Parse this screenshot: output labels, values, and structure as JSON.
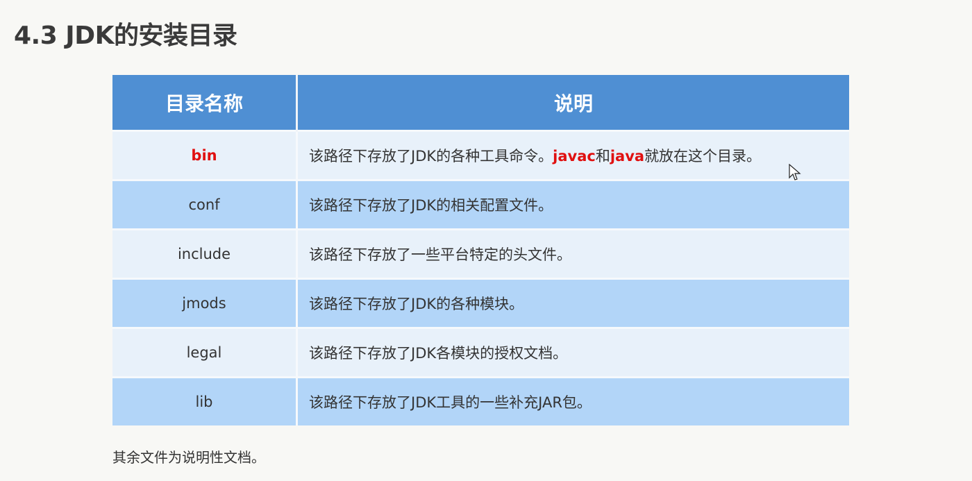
{
  "title": "4.3 JDK的安装目录",
  "table": {
    "headers": [
      "目录名称",
      "说明"
    ],
    "rows": [
      {
        "name": "bin",
        "desc_parts": [
          "该路径下存放了JDK的各种工具命令。",
          "javac",
          "和",
          "java",
          "就放在这个目录。"
        ]
      },
      {
        "name": "conf",
        "desc": "该路径下存放了JDK的相关配置文件。"
      },
      {
        "name": "include",
        "desc": "该路径下存放了一些平台特定的头文件。"
      },
      {
        "name": "jmods",
        "desc": "该路径下存放了JDK的各种模块。"
      },
      {
        "name": "legal",
        "desc": "该路径下存放了JDK各模块的授权文档。"
      },
      {
        "name": "lib",
        "desc": "该路径下存放了JDK工具的一些补充JAR包。"
      }
    ]
  },
  "footer": "其余文件为说明性文档。",
  "colors": {
    "header": "#4f8fd3",
    "row_light": "#e8f1fa",
    "row_dark": "#b2d5f8",
    "highlight": "#e01010"
  }
}
